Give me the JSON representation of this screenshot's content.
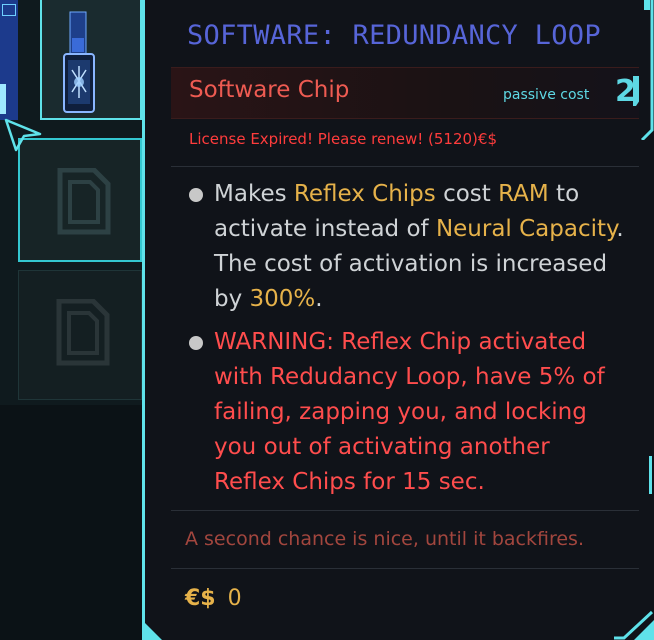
{
  "item": {
    "title": "SOFTWARE: REDUNDANCY LOOP",
    "type": "Software Chip",
    "cost_label": "passive cost",
    "cost_value": "2",
    "license_notice": "License Expired! Please renew! (5120)€$",
    "description": {
      "p1_before_hl1": "Makes ",
      "p1_hl1": "Reflex Chips",
      "p1_between1": " cost ",
      "p1_hl2": "RAM",
      "p1_between2": " to activate instead of ",
      "p1_hl3": "Neural Capacity",
      "p1_between3": ". The cost of activation is increased by ",
      "p1_hl4": "300%",
      "p1_end": ".",
      "warning": "WARNING: Reflex Chip activated with Redudancy Loop, have 5% of failing, zapping you, and locking you out of activating another Reflex Chips for 15 sec."
    },
    "flavor_text": "A second chance is nice, until it backfires.",
    "currency_symbol": "€$",
    "price": "0"
  },
  "colors": {
    "title": "#5765d8",
    "accent_cyan": "#5fe2ea",
    "type_red": "#ee5b52",
    "license_red": "#ff3c3c",
    "highlight_gold": "#e6b24a",
    "warning_red": "#ff4d4d"
  },
  "icons": {
    "chip_item": "software-chip-icon",
    "empty_slot": "empty-chip-slot-icon",
    "cursor": "mouse-cursor-icon"
  }
}
